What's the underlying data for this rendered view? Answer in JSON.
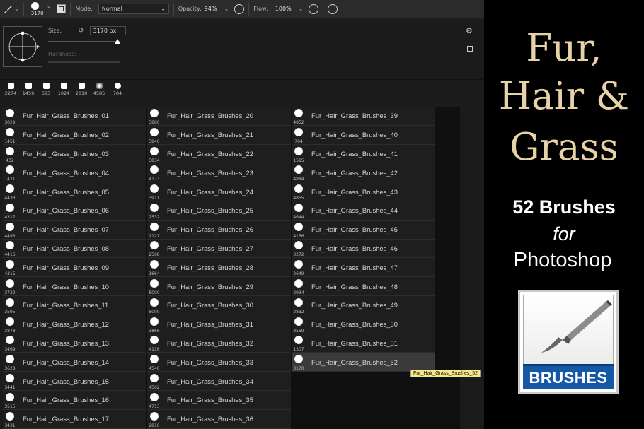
{
  "options": {
    "brush_size_readout": "3170",
    "mode_label": "Mode:",
    "mode_value": "Normal",
    "opacity_label": "Opacity:",
    "opacity_value": "94%",
    "flow_label": "Flow:",
    "flow_value": "100%"
  },
  "panel": {
    "size_label": "Size:",
    "size_value": "3170 px",
    "hardness_label": "Hardness:"
  },
  "recent": [
    "2274",
    "1459",
    "683",
    "1024",
    "2810",
    "4585",
    "704"
  ],
  "brushes": [
    {
      "n": "3029",
      "name": "Fur_Hair_Grass_Brushes_01"
    },
    {
      "n": "1451",
      "name": "Fur_Hair_Grass_Brushes_02"
    },
    {
      "n": "432",
      "name": "Fur_Hair_Grass_Brushes_03"
    },
    {
      "n": "1471",
      "name": "Fur_Hair_Grass_Brushes_04"
    },
    {
      "n": "4433",
      "name": "Fur_Hair_Grass_Brushes_05"
    },
    {
      "n": "4317",
      "name": "Fur_Hair_Grass_Brushes_06"
    },
    {
      "n": "4493",
      "name": "Fur_Hair_Grass_Brushes_07"
    },
    {
      "n": "4416",
      "name": "Fur_Hair_Grass_Brushes_08"
    },
    {
      "n": "4315",
      "name": "Fur_Hair_Grass_Brushes_09"
    },
    {
      "n": "3732",
      "name": "Fur_Hair_Grass_Brushes_10"
    },
    {
      "n": "3595",
      "name": "Fur_Hair_Grass_Brushes_11"
    },
    {
      "n": "3878",
      "name": "Fur_Hair_Grass_Brushes_12"
    },
    {
      "n": "3469",
      "name": "Fur_Hair_Grass_Brushes_13"
    },
    {
      "n": "3628",
      "name": "Fur_Hair_Grass_Brushes_14"
    },
    {
      "n": "3441",
      "name": "Fur_Hair_Grass_Brushes_15"
    },
    {
      "n": "3515",
      "name": "Fur_Hair_Grass_Brushes_16"
    },
    {
      "n": "3431",
      "name": "Fur_Hair_Grass_Brushes_17"
    },
    {
      "n": "3880",
      "name": "Fur_Hair_Grass_Brushes_20"
    },
    {
      "n": "3840",
      "name": "Fur_Hair_Grass_Brushes_21"
    },
    {
      "n": "3834",
      "name": "Fur_Hair_Grass_Brushes_22"
    },
    {
      "n": "4173",
      "name": "Fur_Hair_Grass_Brushes_23"
    },
    {
      "n": "3911",
      "name": "Fur_Hair_Grass_Brushes_24"
    },
    {
      "n": "2532",
      "name": "Fur_Hair_Grass_Brushes_25"
    },
    {
      "n": "2121",
      "name": "Fur_Hair_Grass_Brushes_26"
    },
    {
      "n": "2568",
      "name": "Fur_Hair_Grass_Brushes_27"
    },
    {
      "n": "1664",
      "name": "Fur_Hair_Grass_Brushes_28"
    },
    {
      "n": "5000",
      "name": "Fur_Hair_Grass_Brushes_29"
    },
    {
      "n": "5000",
      "name": "Fur_Hair_Grass_Brushes_30"
    },
    {
      "n": "3866",
      "name": "Fur_Hair_Grass_Brushes_31"
    },
    {
      "n": "4116",
      "name": "Fur_Hair_Grass_Brushes_32"
    },
    {
      "n": "4540",
      "name": "Fur_Hair_Grass_Brushes_33"
    },
    {
      "n": "4562",
      "name": "Fur_Hair_Grass_Brushes_34"
    },
    {
      "n": "4713",
      "name": "Fur_Hair_Grass_Brushes_35"
    },
    {
      "n": "2810",
      "name": "Fur_Hair_Grass_Brushes_36"
    },
    {
      "n": "4852",
      "name": "Fur_Hair_Grass_Brushes_39"
    },
    {
      "n": "704",
      "name": "Fur_Hair_Grass_Brushes_40"
    },
    {
      "n": "1515",
      "name": "Fur_Hair_Grass_Brushes_41"
    },
    {
      "n": "4884",
      "name": "Fur_Hair_Grass_Brushes_42"
    },
    {
      "n": "4855",
      "name": "Fur_Hair_Grass_Brushes_43"
    },
    {
      "n": "4644",
      "name": "Fur_Hair_Grass_Brushes_44"
    },
    {
      "n": "4156",
      "name": "Fur_Hair_Grass_Brushes_45"
    },
    {
      "n": "3272",
      "name": "Fur_Hair_Grass_Brushes_46"
    },
    {
      "n": "2649",
      "name": "Fur_Hair_Grass_Brushes_47"
    },
    {
      "n": "2934",
      "name": "Fur_Hair_Grass_Brushes_48"
    },
    {
      "n": "2832",
      "name": "Fur_Hair_Grass_Brushes_49"
    },
    {
      "n": "3559",
      "name": "Fur_Hair_Grass_Brushes_50"
    },
    {
      "n": "1307",
      "name": "Fur_Hair_Grass_Brushes_51"
    },
    {
      "n": "3170",
      "name": "Fur_Hair_Grass_Brushes_52"
    }
  ],
  "selected_brush": "Fur_Hair_Grass_Brushes_52",
  "tooltip": "Fur_Hair_Grass_Brushes_52",
  "promo": {
    "title_line1": "Fur,",
    "title_line2": "Hair &",
    "title_line3": "Grass",
    "count_line": "52 Brushes",
    "for_line": "for",
    "app_line": "Photoshop",
    "box_label": "BRUSHES",
    "title_color": "#e8d3a6"
  }
}
